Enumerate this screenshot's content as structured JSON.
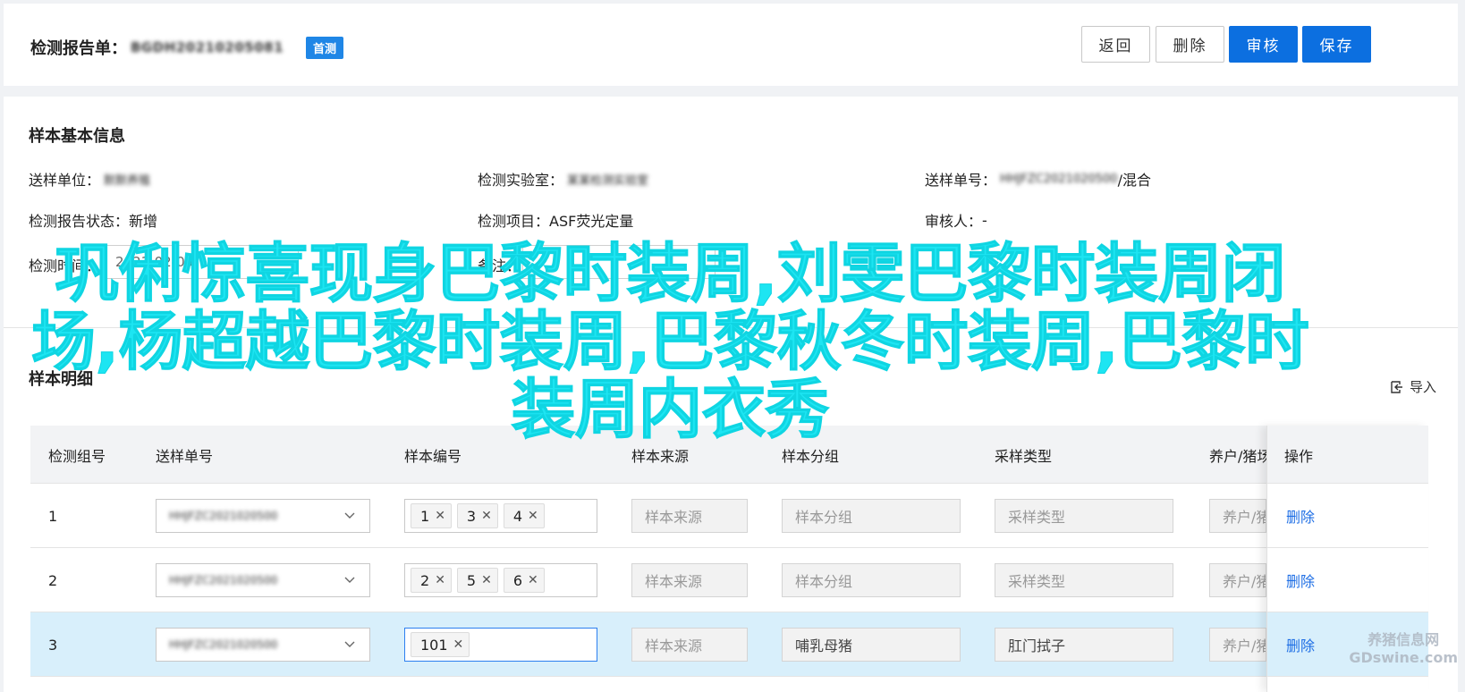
{
  "header": {
    "title": "检测报告单：",
    "report_code": "BGDH20210205081",
    "badge": "首测",
    "buttons": {
      "back": "返回",
      "delete": "删除",
      "review": "审核",
      "save": "保存"
    }
  },
  "sample_info": {
    "section_title": "样本基本信息",
    "unit_label": "送样单位：",
    "unit_value": "默默养殖",
    "lab_label": "检测实验室：",
    "lab_value": "某某检测实验室",
    "order_label": "送样单号：",
    "order_value": "HHJFZC2021020500",
    "order_suffix": "/混合",
    "status_label": "检测报告状态：",
    "status_value": "新增",
    "item_label": "检测项目：",
    "item_value": "ASF荧光定量",
    "reviewer_label": "审核人：",
    "reviewer_value": "-",
    "time_label": "检测时间：",
    "time_value": "2021-02-05",
    "remark_label": "备注："
  },
  "detail": {
    "section_title": "样本明细",
    "import_label": "导入",
    "columns": [
      "检测组号",
      "送样单号",
      "样本编号",
      "样本来源",
      "样本分组",
      "采样类型",
      "养户/猪场",
      "操作"
    ],
    "rows": [
      {
        "idx": "1",
        "order": "HHJFZC2021020500",
        "tags": [
          "1",
          "3",
          "4"
        ],
        "source": "样本来源",
        "group": "样本分组",
        "type": "采样类型",
        "farm": "养户/猪场",
        "op": "删除"
      },
      {
        "idx": "2",
        "order": "HHJFZC2021020500",
        "tags": [
          "2",
          "5",
          "6"
        ],
        "source": "样本来源",
        "group": "样本分组",
        "type": "采样类型",
        "farm": "养户/猪场",
        "op": "删除"
      },
      {
        "idx": "3",
        "order": "HHJFZC2021020500",
        "tags": [
          "101"
        ],
        "source": "样本来源",
        "group": "哺乳母猪",
        "type": "肛门拭子",
        "farm": "养户/猪场",
        "op": "删除"
      }
    ]
  },
  "overlay_text": "巩俐惊喜现身巴黎时装周,刘雯巴黎时装周闭场,杨超越巴黎时装周,巴黎秋冬时装周,巴黎时装周内衣秀",
  "watermark": {
    "line1": "养猪信息网",
    "line2": "GDswine.com"
  },
  "colors": {
    "primary": "#0c6fe0",
    "link": "#1f6fe5",
    "overlay": "#1de5f2",
    "highlight_row": "#d8effb"
  }
}
